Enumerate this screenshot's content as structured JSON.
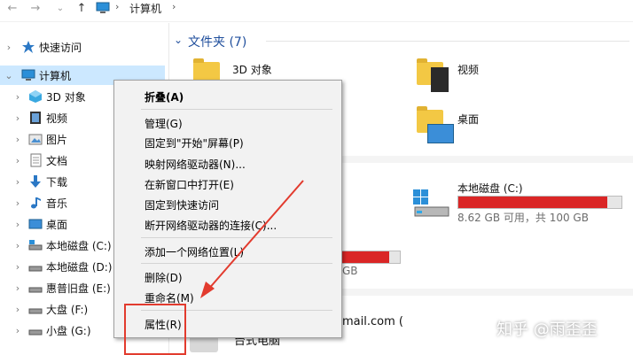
{
  "addressbar": {
    "breadcrumb": [
      "计算机"
    ]
  },
  "sidebar": {
    "items": [
      {
        "label": "快速访问",
        "icon": "star-icon",
        "expanded": false
      },
      {
        "label": "计算机",
        "icon": "computer-icon",
        "expanded": true,
        "selected": true
      },
      {
        "label": "3D 对象",
        "icon": "3d-objects-icon"
      },
      {
        "label": "视频",
        "icon": "video-icon"
      },
      {
        "label": "图片",
        "icon": "pictures-icon"
      },
      {
        "label": "文档",
        "icon": "documents-icon"
      },
      {
        "label": "下载",
        "icon": "download-icon"
      },
      {
        "label": "音乐",
        "icon": "music-icon"
      },
      {
        "label": "桌面",
        "icon": "desktop-icon"
      },
      {
        "label": "本地磁盘 (C:)",
        "icon": "drive-icon"
      },
      {
        "label": "本地磁盘 (D:)",
        "icon": "drive-icon"
      },
      {
        "label": "惠普旧盘 (E:)",
        "icon": "drive-icon"
      },
      {
        "label": "大盘 (F:)",
        "icon": "drive-icon"
      },
      {
        "label": "小盘 (G:)",
        "icon": "drive-icon"
      }
    ]
  },
  "content": {
    "folders_title": "文件夹 (7)",
    "folders": [
      {
        "label": "3D 对象"
      },
      {
        "label": "视频"
      },
      {
        "label": "桌面"
      }
    ],
    "drive_c": {
      "label": "本地磁盘 (C:)",
      "detail": "8.62 GB 可用，共 100 GB",
      "used_fraction": 0.914
    },
    "partial_text_gb": "GB",
    "partial_email": "mail.com (",
    "partial_bottom": "台式电脑"
  },
  "context_menu": {
    "items": [
      {
        "label": "折叠(A)",
        "bold": true
      },
      {
        "label": "管理(G)"
      },
      {
        "label": "固定到\"开始\"屏幕(P)"
      },
      {
        "label": "映射网络驱动器(N)..."
      },
      {
        "label": "在新窗口中打开(E)"
      },
      {
        "label": "固定到快速访问"
      },
      {
        "label": "断开网络驱动器的连接(C)..."
      },
      {
        "label": "添加一个网络位置(L)"
      },
      {
        "label": "删除(D)"
      },
      {
        "label": "重命名(M)"
      },
      {
        "label": "属性(R)"
      }
    ]
  },
  "annotation_color": "#e23b2e",
  "watermark": "知乎 @雨歪歪"
}
